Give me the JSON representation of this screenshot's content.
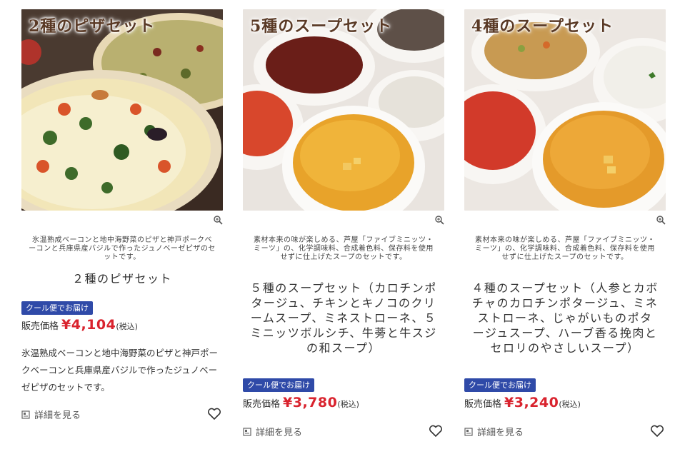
{
  "products": [
    {
      "photo_title": "2種のピザセット",
      "catch_copy": "氷温熟成ベーコンと地中海野菜のピザと神戸ポークベーコンと兵庫県産バジルで作ったジュノベーゼピザのセットです。",
      "name": "２種のピザセット",
      "badge": "クール便でお届け",
      "price_label": "販売価格",
      "price": "¥4,104",
      "tax": "(税込)",
      "description": "氷温熟成ベーコンと地中海野菜のピザと神戸ポークベーコンと兵庫県産バジルで作ったジュノベーゼピザのセットです。",
      "detail_label": "詳細を見る"
    },
    {
      "photo_title": "5種のスープセット",
      "catch_copy": "素材本来の味が楽しめる、芦屋「ファイブミニッツ・ミーツ」の、化学調味料、合成着色料、保存料を使用せずに仕上げたスープのセットです。",
      "name": "５種のスープセット（カロチンポタージュ、チキンとキノコのクリームスープ、ミネストローネ、５ミニッツボルシチ、牛蒡と牛スジの和スープ）",
      "badge": "クール便でお届け",
      "price_label": "販売価格",
      "price": "¥3,780",
      "tax": "(税込)",
      "detail_label": "詳細を見る"
    },
    {
      "photo_title": "4種のスープセット",
      "catch_copy": "素材本来の味が楽しめる、芦屋「ファイブミニッツ・ミーツ」の、化学調味料、合成着色料、保存料を使用せずに仕上げたスープのセットです。",
      "name": "４種のスープセット（人参とカボチャのカロチンポタージュ、ミネストローネ、じゃがいものポタージュスープ、ハーブ香る挽肉とセロリのやさしいスープ）",
      "badge": "クール便でお届け",
      "price_label": "販売価格",
      "price": "¥3,240",
      "tax": "(税込)",
      "detail_label": "詳細を見る"
    }
  ],
  "icons": {
    "zoom": "zoom-in-icon",
    "detail": "document-icon",
    "favorite": "heart-outline-icon"
  },
  "colors": {
    "price": "#d9232e",
    "badge": "#2f4aa8",
    "photo_title": "#5a3a26"
  }
}
